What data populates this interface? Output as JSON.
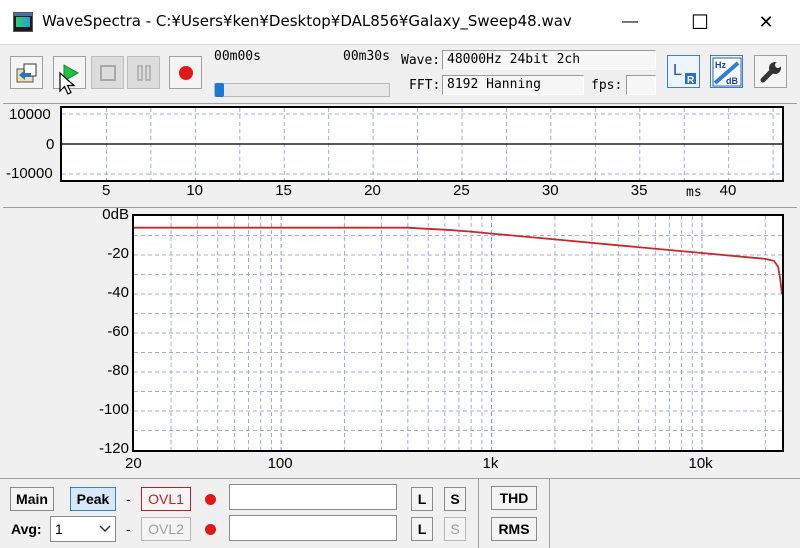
{
  "window": {
    "title": "WaveSpectra - C:¥Users¥ken¥Desktop¥DAL856¥Galaxy_Sweep48.wav",
    "minimize_glyph": "—",
    "maximize_glyph": "☐",
    "close_glyph": "✕"
  },
  "toolbar": {
    "time_start": "00m00s",
    "time_end": "00m30s",
    "progress": 0.0,
    "wave_label": "Wave:",
    "wave_value": "48000Hz 24bit 2ch",
    "fft_label": "FFT:",
    "fft_value": "8192 Hanning",
    "fps_label": "fps:",
    "fps_value": "",
    "icons": [
      "open-file-icon",
      "play-icon",
      "stop-icon",
      "pause-icon",
      "record-icon",
      "lr-channel-icon",
      "hz-db-scale-icon",
      "wrench-icon"
    ],
    "lr_main": "L",
    "lr_sub": "R",
    "hz_label": "Hz",
    "db_label": "dB"
  },
  "wave_plot": {
    "y_ticks": [
      "10000",
      "0",
      "-10000"
    ],
    "x_ticks": [
      "5",
      "10",
      "15",
      "20",
      "25",
      "30",
      "35",
      "40"
    ],
    "x_unit": "ms"
  },
  "spectrum_plot": {
    "y_ticks": [
      "0dB",
      "-20",
      "-40",
      "-60",
      "-80",
      "-100",
      "-120"
    ],
    "x_ticks": [
      "20",
      "100",
      "1k",
      "10k"
    ]
  },
  "chart_data": [
    {
      "type": "line",
      "xlabel": "ms",
      "ylim": [
        -12000,
        12000
      ],
      "xlim": [
        2.5,
        43
      ],
      "series": [
        {
          "x": [
            2.5,
            43
          ],
          "y": [
            0,
            0
          ]
        }
      ]
    },
    {
      "type": "line",
      "x_scale": "log",
      "xlim": [
        20,
        24000
      ],
      "ylim": [
        -120,
        0
      ],
      "series": [
        {
          "color": "#c8282a",
          "x": [
            20,
            100,
            200,
            400,
            480,
            600,
            800,
            1000,
            2000,
            4000,
            10000,
            20000,
            22000,
            23000,
            23500,
            24000
          ],
          "y": [
            -6,
            -6,
            -6,
            -6,
            -6.5,
            -7,
            -8,
            -9,
            -12,
            -15,
            -19,
            -22,
            -23,
            -26,
            -32,
            -40
          ]
        }
      ]
    }
  ],
  "bottom": {
    "main_label": "Main",
    "peak_label": "Peak",
    "dash": "-",
    "ovl1_label": "OVL1",
    "ovl2_label": "OVL2",
    "l_label": "L",
    "s_label": "S",
    "thd_label": "THD",
    "rms_label": "RMS",
    "avg_label": "Avg:",
    "avg_value": "1",
    "text1": "",
    "text2": ""
  }
}
